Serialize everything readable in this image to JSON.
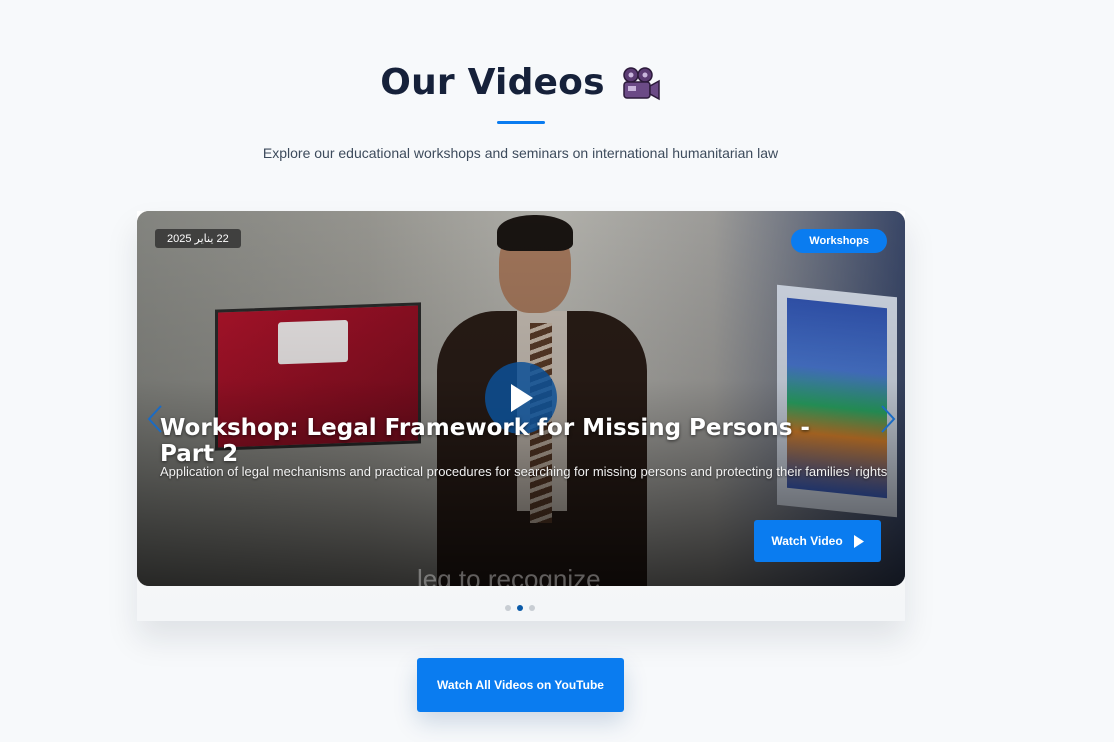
{
  "section": {
    "title": "Our Videos",
    "title_icon": "movie-camera-icon",
    "subtitle": "Explore our educational workshops and seminars on international humanitarian law"
  },
  "carousel": {
    "active_slide": {
      "date": "22 يناير 2025",
      "category": "Workshops",
      "title": "Workshop: Legal Framework for Missing Persons - Part 2",
      "description": "Application of legal mechanisms and practical procedures for searching for missing persons and protecting their families' rights",
      "watch_label": "Watch Video",
      "video_caption": "leg to recognize"
    },
    "dots_count": 3,
    "active_dot": 2
  },
  "youtube_button": {
    "label": "Watch All Videos on YouTube"
  },
  "colors": {
    "accent": "#0a7cf0",
    "title": "#16213a",
    "background": "#f7f9fb"
  }
}
